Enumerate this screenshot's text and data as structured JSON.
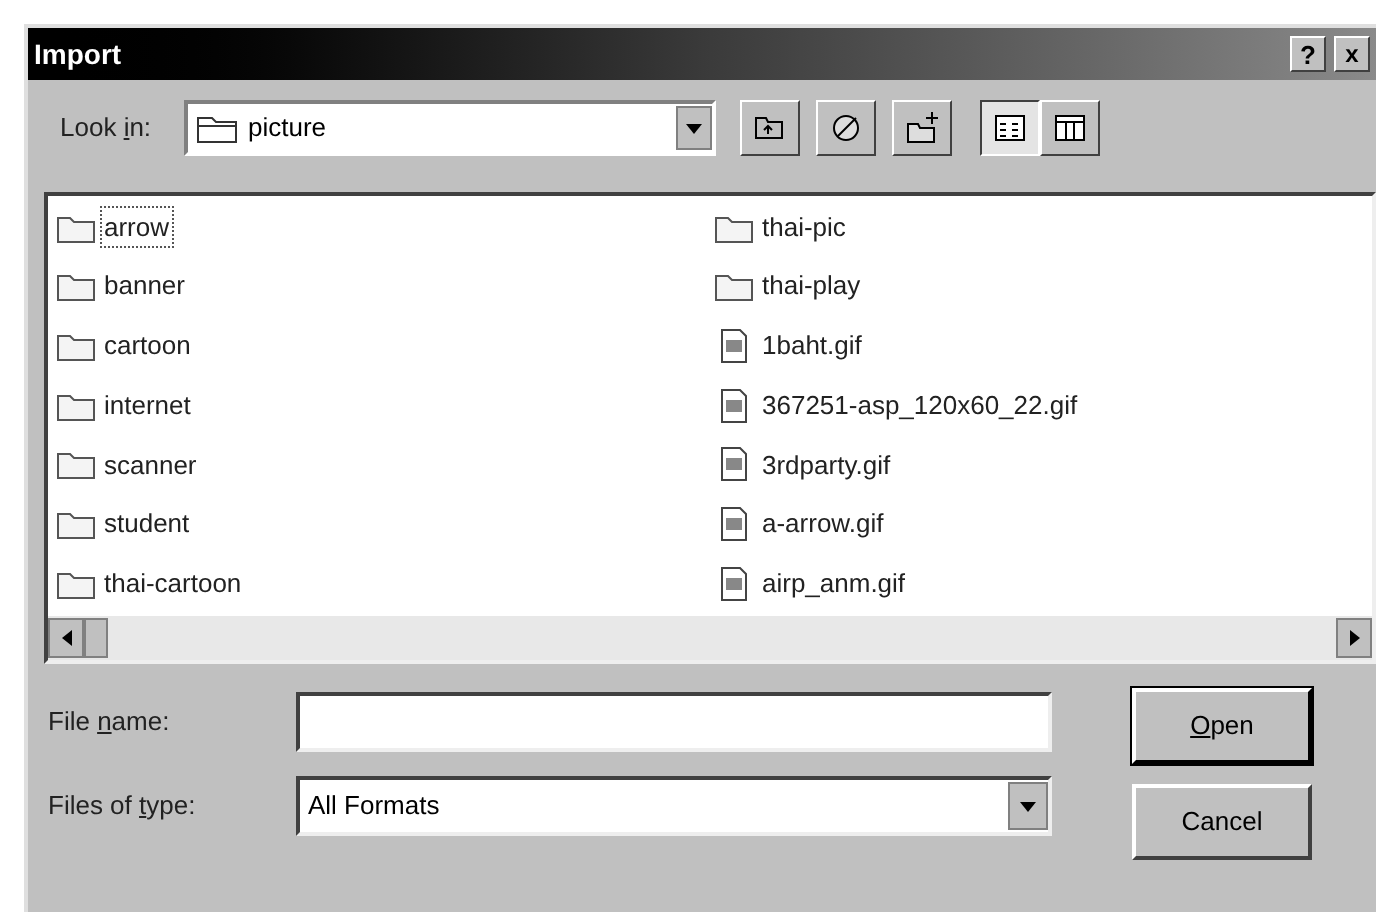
{
  "window": {
    "title": "Import",
    "buttons": [
      {
        "kind": "help",
        "label": "?"
      },
      {
        "kind": "close",
        "label": "x"
      }
    ]
  },
  "look_in": {
    "label": {
      "before": "Look ",
      "key": "i",
      "after": "n:"
    },
    "value": "picture"
  },
  "toolbar": [
    {
      "kind": "up"
    },
    {
      "kind": "desktop"
    },
    {
      "kind": "new-folder"
    },
    {
      "kind": "list",
      "selected": true
    },
    {
      "kind": "details",
      "selected": false
    }
  ],
  "files": [
    {
      "name": "arrow",
      "kind": "folder",
      "focused": true
    },
    {
      "name": "banner",
      "kind": "folder",
      "focused": false
    },
    {
      "name": "cartoon",
      "kind": "folder",
      "focused": false
    },
    {
      "name": "internet",
      "kind": "folder",
      "focused": false
    },
    {
      "name": "scanner",
      "kind": "folder",
      "focused": false
    },
    {
      "name": "student",
      "kind": "folder",
      "focused": false
    },
    {
      "name": "thai-cartoon",
      "kind": "folder",
      "focused": false
    },
    {
      "name": "thai-pic",
      "kind": "folder",
      "focused": false
    },
    {
      "name": "thai-play",
      "kind": "folder",
      "focused": false
    },
    {
      "name": "1baht.gif",
      "kind": "file",
      "focused": false
    },
    {
      "name": "367251-asp_120x60_22.gif",
      "kind": "file",
      "focused": false
    },
    {
      "name": "3rdparty.gif",
      "kind": "file",
      "focused": false
    },
    {
      "name": "a-arrow.gif",
      "kind": "file",
      "focused": false
    },
    {
      "name": "airp_anm.gif",
      "kind": "file",
      "focused": false
    }
  ],
  "file_name": {
    "label": {
      "before": "File ",
      "key": "n",
      "after": "ame:"
    }
  },
  "file_type": {
    "label": {
      "before": "Files of ",
      "key": "t",
      "after": "ype:"
    },
    "value": "All Formats"
  },
  "buttons": [
    {
      "label": {
        "key": "O",
        "after": "pen"
      },
      "default": true
    },
    {
      "label": {
        "before": "Cancel"
      },
      "default": false
    }
  ]
}
